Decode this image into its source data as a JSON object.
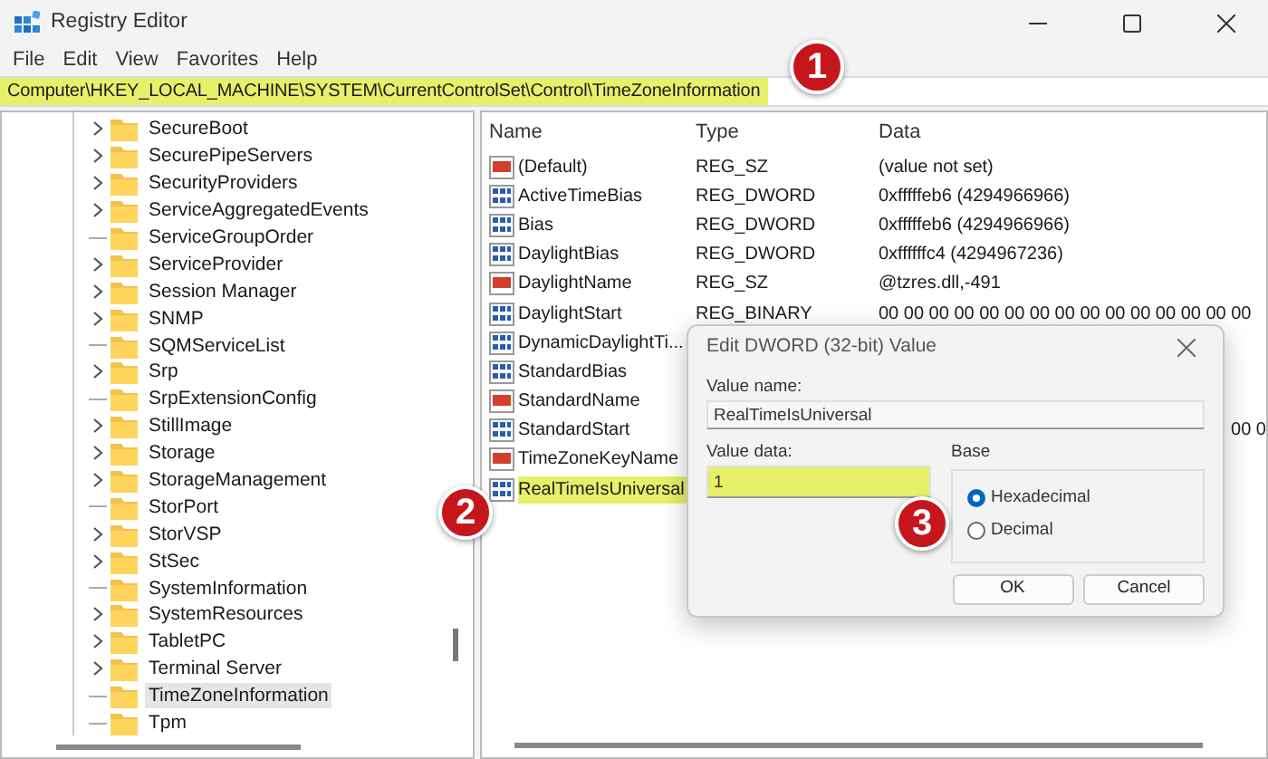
{
  "window": {
    "title": "Registry Editor"
  },
  "menu": [
    "File",
    "Edit",
    "View",
    "Favorites",
    "Help"
  ],
  "address": {
    "path": "Computer\\HKEY_LOCAL_MACHINE\\SYSTEM\\CurrentControlSet\\Control\\TimeZoneInformation",
    "highlighted": true
  },
  "tree": [
    {
      "label": "SecureBoot",
      "expandable": true,
      "selected": false
    },
    {
      "label": "SecurePipeServers",
      "expandable": true,
      "selected": false
    },
    {
      "label": "SecurityProviders",
      "expandable": true,
      "selected": false
    },
    {
      "label": "ServiceAggregatedEvents",
      "expandable": true,
      "selected": false
    },
    {
      "label": "ServiceGroupOrder",
      "expandable": false,
      "selected": false
    },
    {
      "label": "ServiceProvider",
      "expandable": true,
      "selected": false
    },
    {
      "label": "Session Manager",
      "expandable": true,
      "selected": false
    },
    {
      "label": "SNMP",
      "expandable": true,
      "selected": false
    },
    {
      "label": "SQMServiceList",
      "expandable": false,
      "selected": false
    },
    {
      "label": "Srp",
      "expandable": true,
      "selected": false
    },
    {
      "label": "SrpExtensionConfig",
      "expandable": false,
      "selected": false
    },
    {
      "label": "StillImage",
      "expandable": true,
      "selected": false
    },
    {
      "label": "Storage",
      "expandable": true,
      "selected": false
    },
    {
      "label": "StorageManagement",
      "expandable": true,
      "selected": false
    },
    {
      "label": "StorPort",
      "expandable": false,
      "selected": false
    },
    {
      "label": "StorVSP",
      "expandable": true,
      "selected": false
    },
    {
      "label": "StSec",
      "expandable": true,
      "selected": false
    },
    {
      "label": "SystemInformation",
      "expandable": false,
      "selected": false
    },
    {
      "label": "SystemResources",
      "expandable": true,
      "selected": false
    },
    {
      "label": "TabletPC",
      "expandable": true,
      "selected": false
    },
    {
      "label": "Terminal Server",
      "expandable": true,
      "selected": false
    },
    {
      "label": "TimeZoneInformation",
      "expandable": false,
      "selected": true
    },
    {
      "label": "Tpm",
      "expandable": false,
      "selected": false
    }
  ],
  "values": {
    "columns": [
      "Name",
      "Type",
      "Data"
    ],
    "rows": [
      {
        "name": "(Default)",
        "kind": "string",
        "type": "REG_SZ",
        "data": "(value not set)",
        "highlighted": false
      },
      {
        "name": "ActiveTimeBias",
        "kind": "binary",
        "type": "REG_DWORD",
        "data": "0xfffffeb6 (4294966966)",
        "highlighted": false
      },
      {
        "name": "Bias",
        "kind": "binary",
        "type": "REG_DWORD",
        "data": "0xfffffeb6 (4294966966)",
        "highlighted": false
      },
      {
        "name": "DaylightBias",
        "kind": "binary",
        "type": "REG_DWORD",
        "data": "0xffffffc4 (4294967236)",
        "highlighted": false
      },
      {
        "name": "DaylightName",
        "kind": "string",
        "type": "REG_SZ",
        "data": "@tzres.dll,-491",
        "highlighted": false
      },
      {
        "name": "DaylightStart",
        "kind": "binary",
        "type": "REG_BINARY",
        "data": "00 00 00 00 00 00 00 00 00 00 00 00 00 00 00",
        "highlighted": false
      },
      {
        "name": "DynamicDaylightTi...",
        "kind": "binary",
        "highlighted": false
      },
      {
        "name": "StandardBias",
        "kind": "binary",
        "highlighted": false
      },
      {
        "name": "StandardName",
        "kind": "string",
        "highlighted": false
      },
      {
        "name": "StandardStart",
        "kind": "binary",
        "data_tail": "00 0",
        "highlighted": false
      },
      {
        "name": "TimeZoneKeyName",
        "kind": "string",
        "highlighted": false
      },
      {
        "name": "RealTimeIsUniversal",
        "kind": "binary",
        "highlighted": true
      }
    ]
  },
  "dialog": {
    "title": "Edit DWORD (32-bit) Value",
    "value_name_label": "Value name:",
    "value_name": "RealTimeIsUniversal",
    "value_data_label": "Value data:",
    "value_data": "1",
    "value_data_highlighted": true,
    "base_label": "Base",
    "bases": [
      {
        "label": "Hexadecimal",
        "selected": true
      },
      {
        "label": "Decimal",
        "selected": false
      }
    ],
    "buttons": [
      "OK",
      "Cancel"
    ]
  },
  "callouts": [
    "1",
    "2",
    "3"
  ]
}
